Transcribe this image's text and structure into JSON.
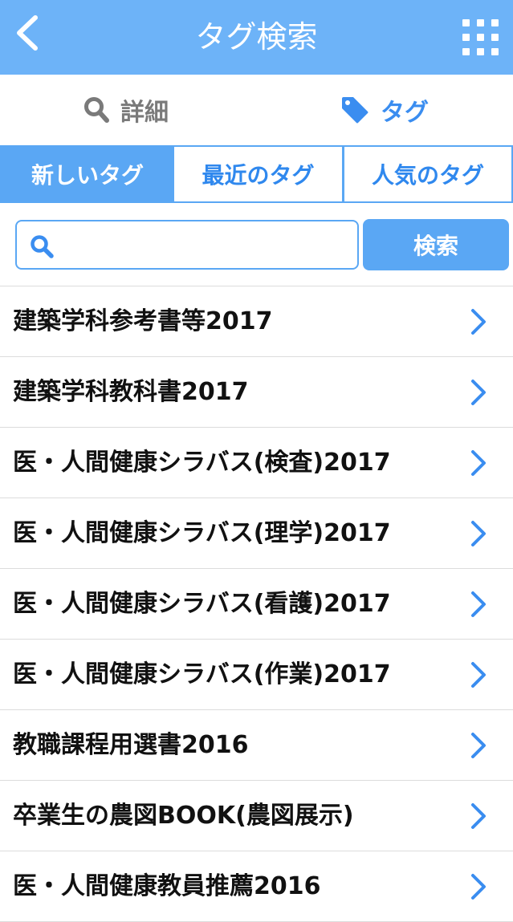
{
  "header": {
    "title": "タグ検索",
    "back_icon": "chevron-left-icon",
    "menu_icon": "grid-menu-icon",
    "color": "#6db3f8"
  },
  "mode": {
    "detail_label": "詳細",
    "tag_label": "タグ",
    "active": "tag",
    "accent": "#3a8df0"
  },
  "tabs": [
    {
      "label": "新しいタグ",
      "selected": true
    },
    {
      "label": "最近のタグ",
      "selected": false
    },
    {
      "label": "人気のタグ",
      "selected": false
    }
  ],
  "search": {
    "value": "",
    "placeholder": "",
    "button_label": "検索"
  },
  "list": {
    "items": [
      {
        "label": "建築学科参考書等2017"
      },
      {
        "label": "建築学科教科書2017"
      },
      {
        "label": "医・人間健康シラバス(検査)2017"
      },
      {
        "label": "医・人間健康シラバス(理学)2017"
      },
      {
        "label": "医・人間健康シラバス(看護)2017"
      },
      {
        "label": "医・人間健康シラバス(作業)2017"
      },
      {
        "label": "教職課程用選書2016"
      },
      {
        "label": "卒業生の農図BOOK(農図展示)"
      },
      {
        "label": "医・人間健康教員推薦2016"
      }
    ]
  }
}
